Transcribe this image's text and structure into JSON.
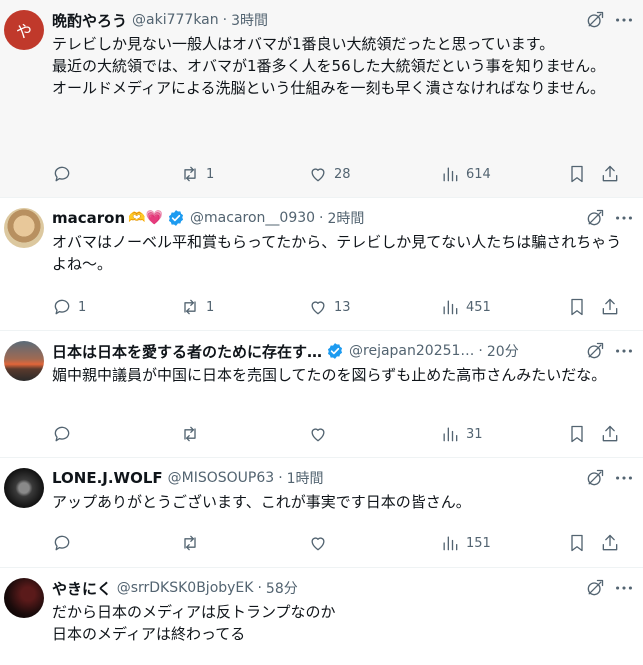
{
  "colors": {
    "secondary": "#536471",
    "primary_text": "#0f1419",
    "verified": "#1d9bf0",
    "avatar_letter_bg": "#c0392b"
  },
  "posts": [
    {
      "avatar_letter": "や",
      "name": "晩酌やろう",
      "handle": "@aki777kan",
      "time": "3時間",
      "text": "テレビしか見ない一般人はオバマが1番良い大統領だったと思っています。\n最近の大統領では、オバマが1番多く人を56した大統領だという事を知りません。\nオールドメディアによる洗脳という仕組みを一刻も早く潰さなければなりません。",
      "counts": {
        "replies": "",
        "reposts": "1",
        "likes": "28",
        "views": "614"
      }
    },
    {
      "name": "macaron",
      "name_emoji": "🫶💗",
      "verified": true,
      "handle": "@macaron__0930",
      "time": "2時間",
      "text": "オバマはノーベル平和賞もらってたから、テレビしか見てない人たちは騙されちゃうよね〜。",
      "counts": {
        "replies": "1",
        "reposts": "1",
        "likes": "13",
        "views": "451"
      }
    },
    {
      "name": "日本は日本を愛する者のために存在す…",
      "verified": true,
      "handle": "@rejapan20251…",
      "time": "20分",
      "text": "媚中親中議員が中国に日本を売国してたのを図らずも止めた高市さんみたいだな。",
      "counts": {
        "replies": "",
        "reposts": "",
        "likes": "",
        "views": "31"
      }
    },
    {
      "name": "LONE.J.WOLF",
      "handle": "@MISOSOUP63",
      "time": "1時間",
      "text": "アップありがとうございます、これが事実です日本の皆さん。",
      "counts": {
        "replies": "",
        "reposts": "",
        "likes": "",
        "views": "151"
      }
    },
    {
      "name": "やきにく",
      "handle": "@srrDKSK0BjobyEK",
      "time": "58分",
      "text": "だから日本のメディアは反トランプなのか\n日本のメディアは終わってる",
      "counts": {
        "replies": "",
        "reposts": "",
        "likes": "",
        "views": ""
      }
    }
  ],
  "icons": [
    "reply-icon",
    "repost-icon",
    "like-icon",
    "views-icon",
    "bookmark-icon",
    "share-icon",
    "grok-icon",
    "more-icon",
    "verified-badge-icon"
  ]
}
